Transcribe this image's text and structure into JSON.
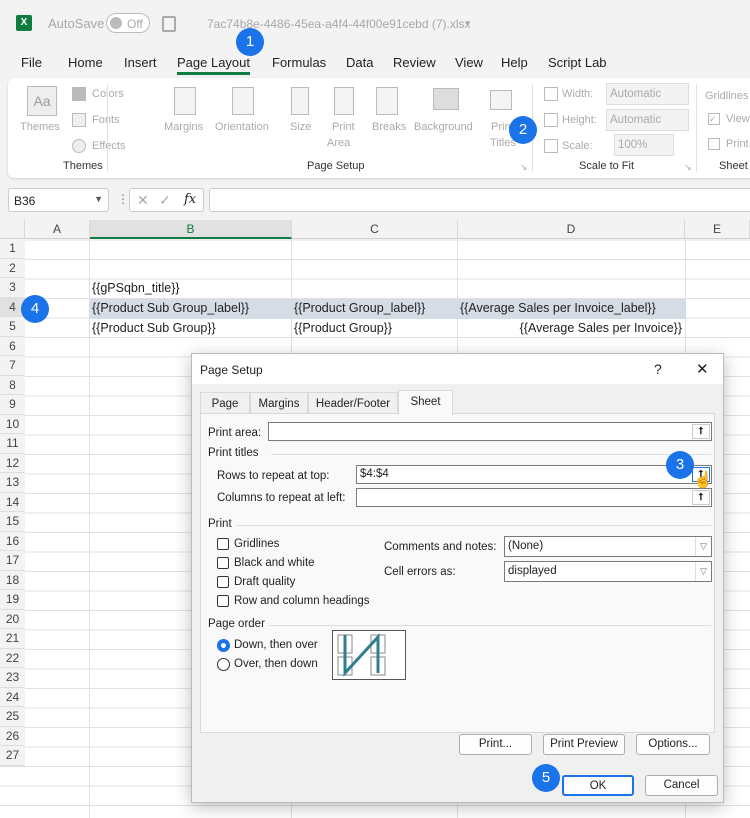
{
  "titlebar": {
    "autosave_label": "AutoSave",
    "autosave_state": "Off",
    "filename": "7ac74b8e-4486-45ea-a4f4-44f00e91cebd (7).xlsx"
  },
  "menu": {
    "tabs": [
      "File",
      "Home",
      "Insert",
      "Page Layout",
      "Formulas",
      "Data",
      "Review",
      "View",
      "Help",
      "Script Lab"
    ],
    "active": "Page Layout"
  },
  "ribbon": {
    "themes": {
      "themes": "Themes",
      "colors": "Colors",
      "fonts": "Fonts",
      "effects": "Effects",
      "group": "Themes"
    },
    "page_setup": {
      "margins": "Margins",
      "orientation": "Orientation",
      "size": "Size",
      "print_area_1": "Print",
      "print_area_2": "Area",
      "breaks": "Breaks",
      "background": "Background",
      "print_titles_1": "Print",
      "print_titles_2": "Titles",
      "group": "Page Setup"
    },
    "scale": {
      "width": "Width:",
      "width_val": "Automatic",
      "height": "Height:",
      "height_val": "Automatic",
      "scale": "Scale:",
      "scale_val": "100%",
      "group": "Scale to Fit"
    },
    "sheet": {
      "gridlines": "Gridlines",
      "view": "View",
      "print": "Print",
      "group": "Sheet"
    }
  },
  "formula_bar": {
    "name_box": "B36",
    "fx": "fx",
    "value": ""
  },
  "grid": {
    "columns": [
      "A",
      "B",
      "C",
      "D",
      "E"
    ],
    "rows": [
      "1",
      "2",
      "3",
      "4",
      "5",
      "6",
      "7",
      "8",
      "9",
      "10",
      "11",
      "12",
      "13",
      "14",
      "15",
      "16",
      "17",
      "18",
      "19",
      "20",
      "21",
      "22",
      "23",
      "24",
      "25",
      "26",
      "27"
    ],
    "b3": "{{gPSqbn_title}}",
    "b4": "{{Product Sub Group_label}}",
    "c4": "{{Product Group_label}}",
    "d4": "{{Average Sales per Invoice_label}}",
    "b5": "{{Product Sub Group}}",
    "c5": "{{Product Group}}",
    "d5": "{{Average Sales per Invoice}}"
  },
  "dialog": {
    "title": "Page Setup",
    "help": "?",
    "close": "✕",
    "tabs": [
      "Page",
      "Margins",
      "Header/Footer",
      "Sheet"
    ],
    "active_tab": "Sheet",
    "print_area_label": "Print area:",
    "print_area_value": "",
    "print_titles": "Print titles",
    "rows_label": "Rows to repeat at top:",
    "rows_value": "$4:$4",
    "cols_label": "Columns to repeat at left:",
    "cols_value": "",
    "print_section": "Print",
    "checkboxes": [
      {
        "label": "Gridlines",
        "checked": false
      },
      {
        "label": "Black and white",
        "checked": false
      },
      {
        "label": "Draft quality",
        "checked": false
      },
      {
        "label": "Row and column headings",
        "checked": false
      }
    ],
    "comments_label": "Comments and notes:",
    "comments_value": "(None)",
    "errors_label": "Cell errors as:",
    "errors_value": "displayed",
    "page_order": "Page order",
    "order_options": [
      {
        "label": "Down, then over",
        "selected": true
      },
      {
        "label": "Over, then down",
        "selected": false
      }
    ],
    "buttons": {
      "print": "Print...",
      "preview": "Print Preview",
      "options": "Options...",
      "ok": "OK",
      "cancel": "Cancel"
    }
  },
  "badges": [
    "1",
    "2",
    "3",
    "4",
    "5"
  ],
  "colors": {
    "accent": "#1a73e8",
    "excel_green": "#107c41",
    "selection": "#d6dce5"
  }
}
